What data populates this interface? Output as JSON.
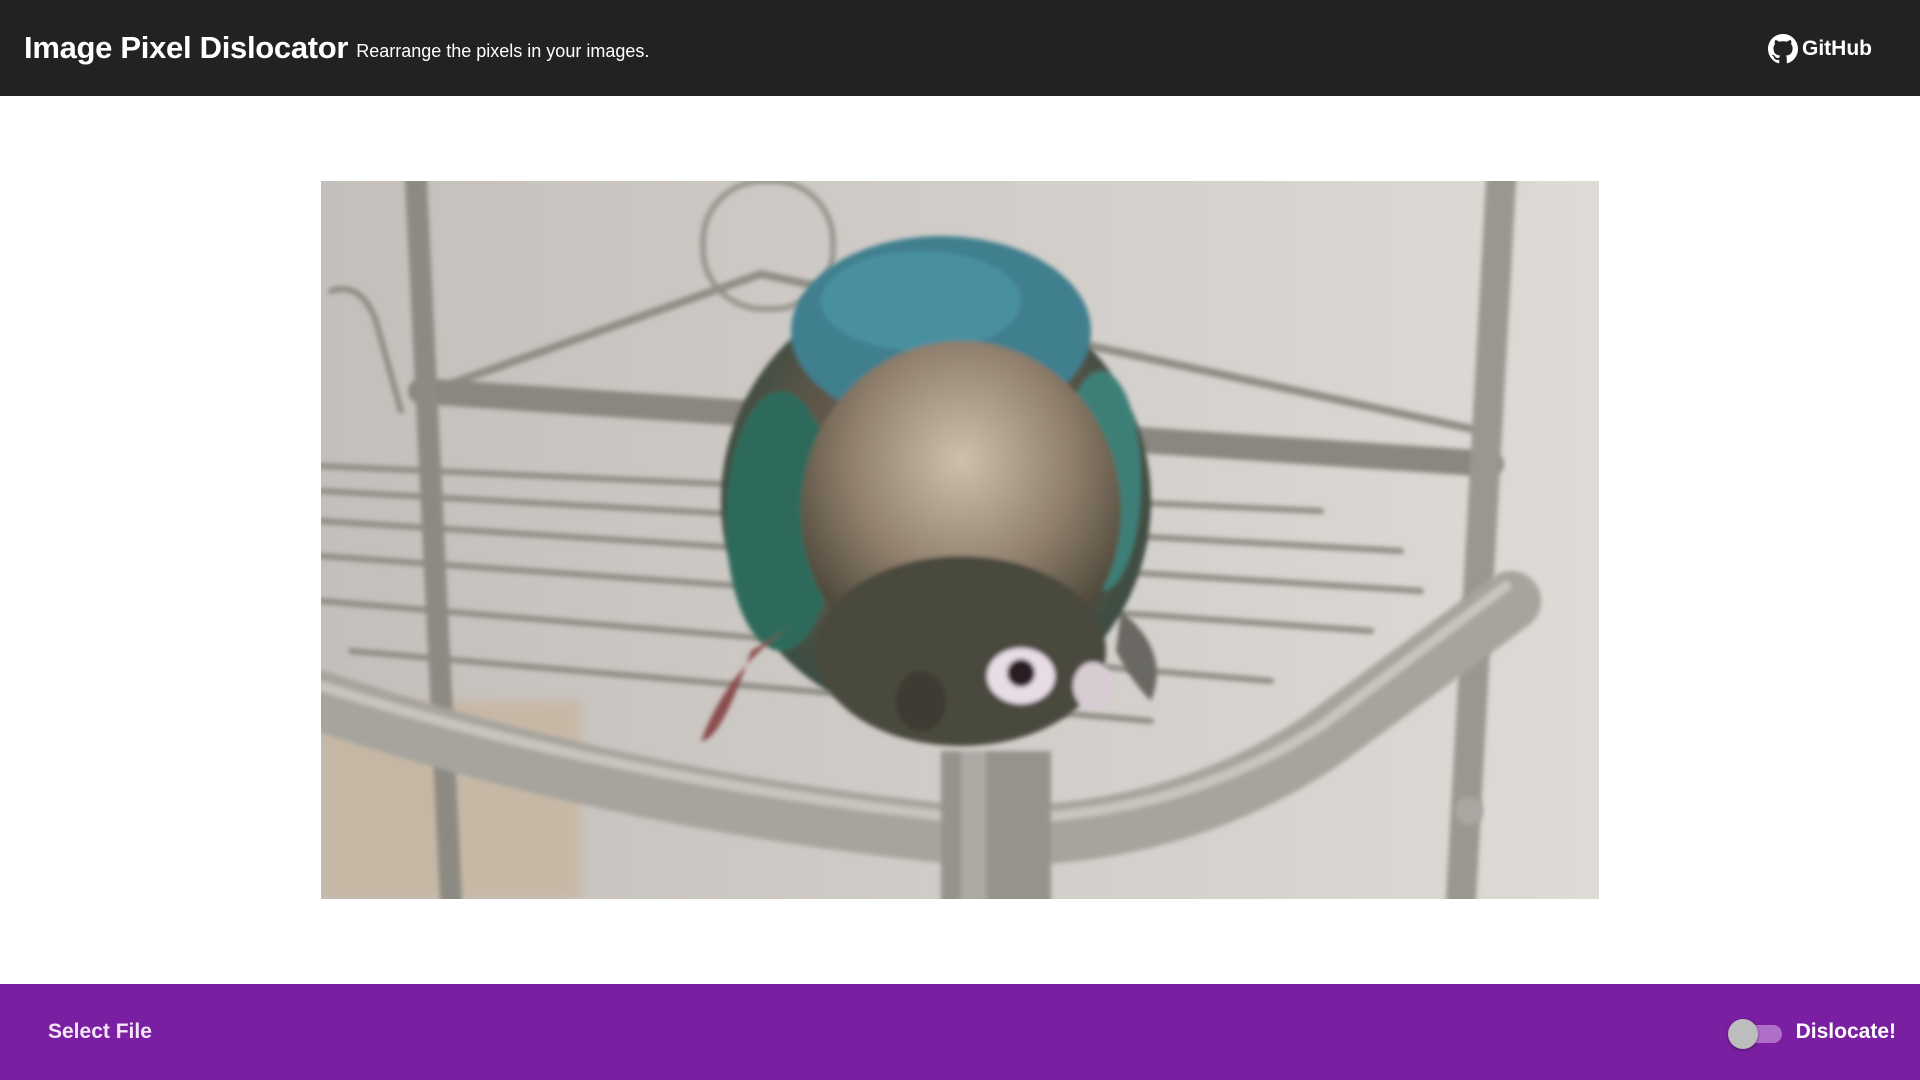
{
  "header": {
    "title": "Image Pixel Dislocator",
    "subtitle": "Rearrange the pixels in your images.",
    "github_label": "GitHub",
    "github_icon": "github-icon"
  },
  "viewer": {
    "image_subject": "photo-of-parrot-on-metal-shelf"
  },
  "footer": {
    "select_file_label": "Select File",
    "dislocate_label": "Dislocate!",
    "dislocate_enabled": false
  },
  "colors": {
    "header_bg": "#222222",
    "footer_bg": "#7b1fa2",
    "toggle_track": "#b06fc7",
    "toggle_thumb": "#bdbdbd"
  }
}
